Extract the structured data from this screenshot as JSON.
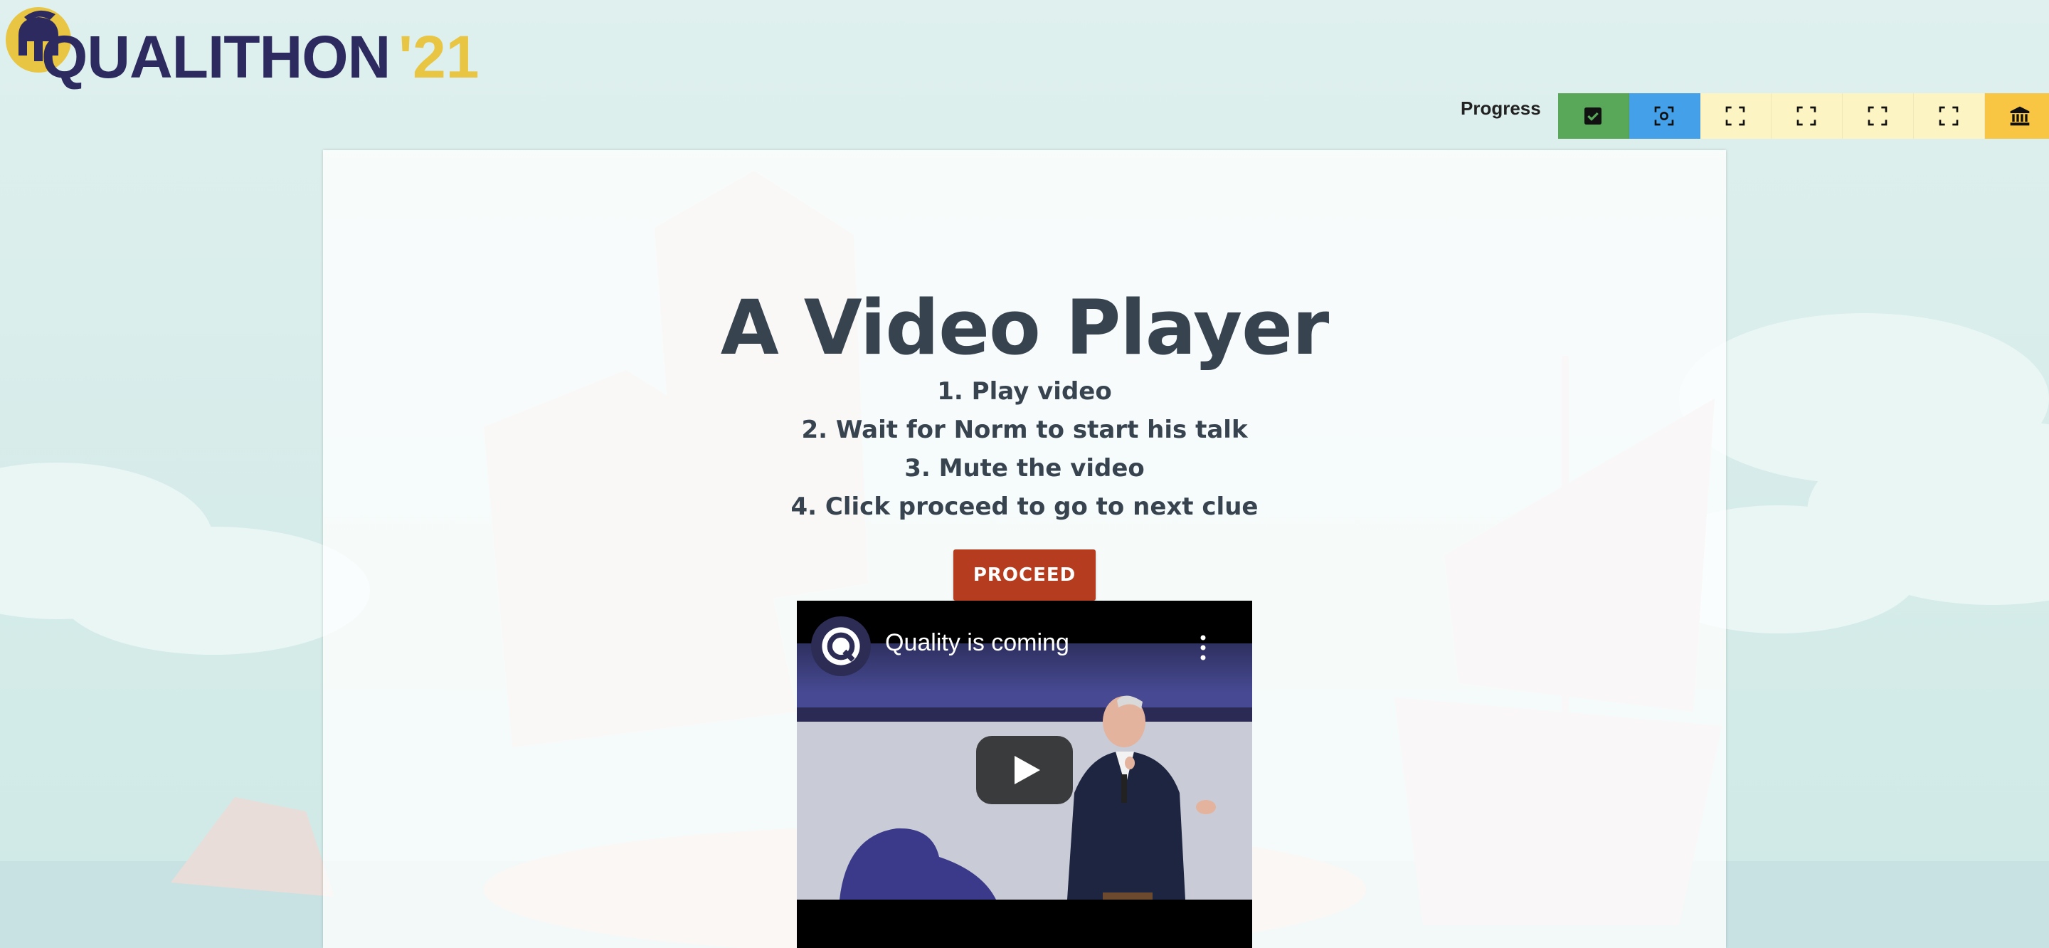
{
  "header": {
    "logo_text": "QUALITHON",
    "logo_year": "'21",
    "progress_label": "Progress",
    "progress_steps": [
      {
        "state": "done",
        "icon": "checkbox-checked-icon"
      },
      {
        "state": "current",
        "icon": "focus-target-icon"
      },
      {
        "state": "todo",
        "icon": "frame-corners-icon"
      },
      {
        "state": "todo",
        "icon": "frame-corners-icon"
      },
      {
        "state": "todo",
        "icon": "frame-corners-icon"
      },
      {
        "state": "todo",
        "icon": "frame-corners-icon"
      },
      {
        "state": "final",
        "icon": "bank-icon"
      }
    ]
  },
  "main": {
    "title": "A Video Player",
    "instructions": [
      "1. Play video",
      "2. Wait for Norm to start his talk",
      "3. Mute the video",
      "4. Click proceed to go to next clue"
    ],
    "proceed_label": "PROCEED"
  },
  "video": {
    "title": "Quality is coming",
    "channel_icon": "q-logo-icon",
    "menu_icon": "more-vertical-icon",
    "play_icon": "youtube-play-icon"
  },
  "colors": {
    "accent_proceed": "#b53c1f",
    "progress_done": "#59a85a",
    "progress_current": "#45a0ea",
    "progress_todo": "#fdf4c4",
    "progress_final": "#f8c643",
    "logo_text": "#2c2a5e",
    "logo_year": "#e8c543"
  }
}
